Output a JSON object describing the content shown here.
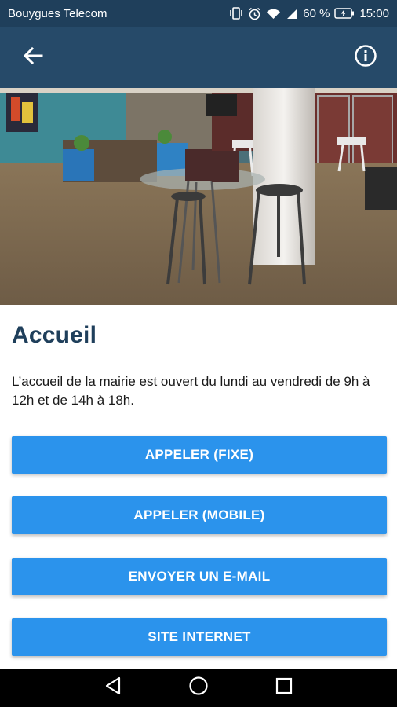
{
  "status_bar": {
    "carrier": "Bouygues Telecom",
    "battery_percent": "60 %",
    "time": "15:00",
    "icons": [
      "vibrate-icon",
      "alarm-icon",
      "wifi-icon",
      "signal-icon",
      "battery-charging-icon"
    ]
  },
  "app_bar": {
    "back_icon": "arrow-back-icon",
    "info_icon": "info-icon"
  },
  "hero": {
    "image": "reception-hall-photo"
  },
  "page": {
    "title": "Accueil",
    "description": "L’accueil de la mairie est ouvert du lundi au vendredi de 9h à 12h et de 14h à 18h."
  },
  "actions": {
    "call_landline": "APPELER (FIXE)",
    "call_mobile": "APPELER (MOBILE)",
    "send_email": "ENVOYER UN E-MAIL",
    "website": "SITE INTERNET"
  },
  "nav": {
    "icons": [
      "nav-back-icon",
      "nav-home-icon",
      "nav-recents-icon"
    ]
  },
  "colors": {
    "status_bar": "#1f3f5b",
    "app_bar": "#264a69",
    "title": "#1f3f5b",
    "button": "#2b93ec"
  }
}
